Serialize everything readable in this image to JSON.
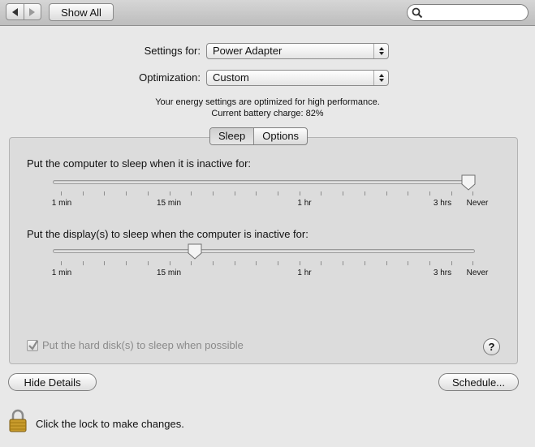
{
  "toolbar": {
    "show_all_label": "Show All",
    "search": {
      "value": "",
      "placeholder": ""
    }
  },
  "settings_for": {
    "label": "Settings for:",
    "selected": "Power Adapter"
  },
  "optimization": {
    "label": "Optimization:",
    "selected": "Custom"
  },
  "info": {
    "line1": "Your energy settings are optimized for high performance.",
    "line2": "Current battery charge: 82%"
  },
  "tabs": [
    {
      "label": "Sleep",
      "selected": true
    },
    {
      "label": "Options",
      "selected": false
    }
  ],
  "computer_sleep": {
    "label": "Put the computer to sleep when it is inactive for:",
    "value": "Never"
  },
  "display_sleep": {
    "label": "Put the display(s) to sleep when the computer is inactive for:",
    "value": "20 min"
  },
  "tick_labels": [
    "1 min",
    "15 min",
    "1 hr",
    "3 hrs",
    "Never"
  ],
  "hard_disk_sleep": {
    "label": "Put the hard disk(s) to sleep when possible",
    "checked": true,
    "enabled": false
  },
  "help_label": "?",
  "hide_details_label": "Hide Details",
  "schedule_label": "Schedule...",
  "lock": {
    "text": "Click the lock to make changes.",
    "icon": "lock-icon"
  }
}
